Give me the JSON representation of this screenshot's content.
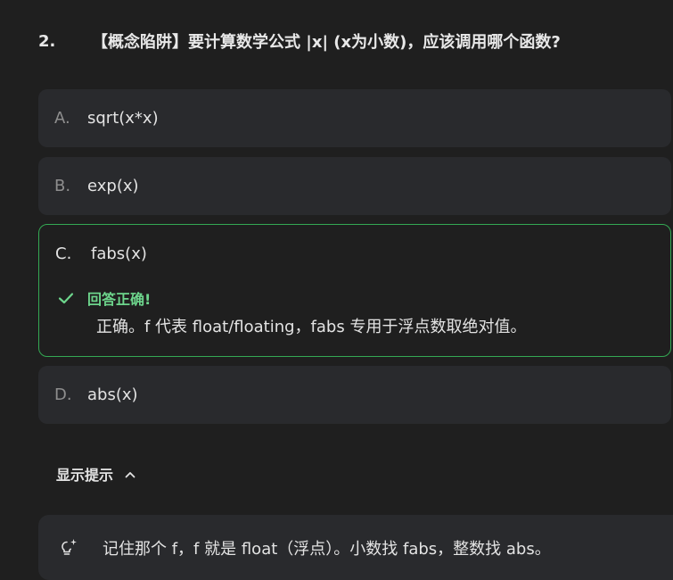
{
  "question": {
    "number": "2.",
    "text": "【概念陷阱】要计算数学公式 |x| (x为小数)，应该调用哪个函数?"
  },
  "options": [
    {
      "letter": "A.",
      "text": "sqrt(x*x)"
    },
    {
      "letter": "B.",
      "text": "exp(x)"
    },
    {
      "letter": "C.",
      "text": "fabs(x)"
    },
    {
      "letter": "D.",
      "text": "abs(x)"
    }
  ],
  "feedback": {
    "status": "回答正确!",
    "explanation": "正确。f 代表 float/floating，fabs 专用于浮点数取绝对值。"
  },
  "hint": {
    "toggle_label": "显示提示",
    "text": "记住那个 f，f 就是 float（浮点）。小数找 fabs，整数找 abs。"
  },
  "colors": {
    "background": "#1f1f1f",
    "option_bg": "#292a2d",
    "correct": "#34a853",
    "correct_text": "#6dd58c"
  },
  "icons": [
    "check-icon",
    "chevron-up-icon",
    "lightbulb-icon"
  ]
}
